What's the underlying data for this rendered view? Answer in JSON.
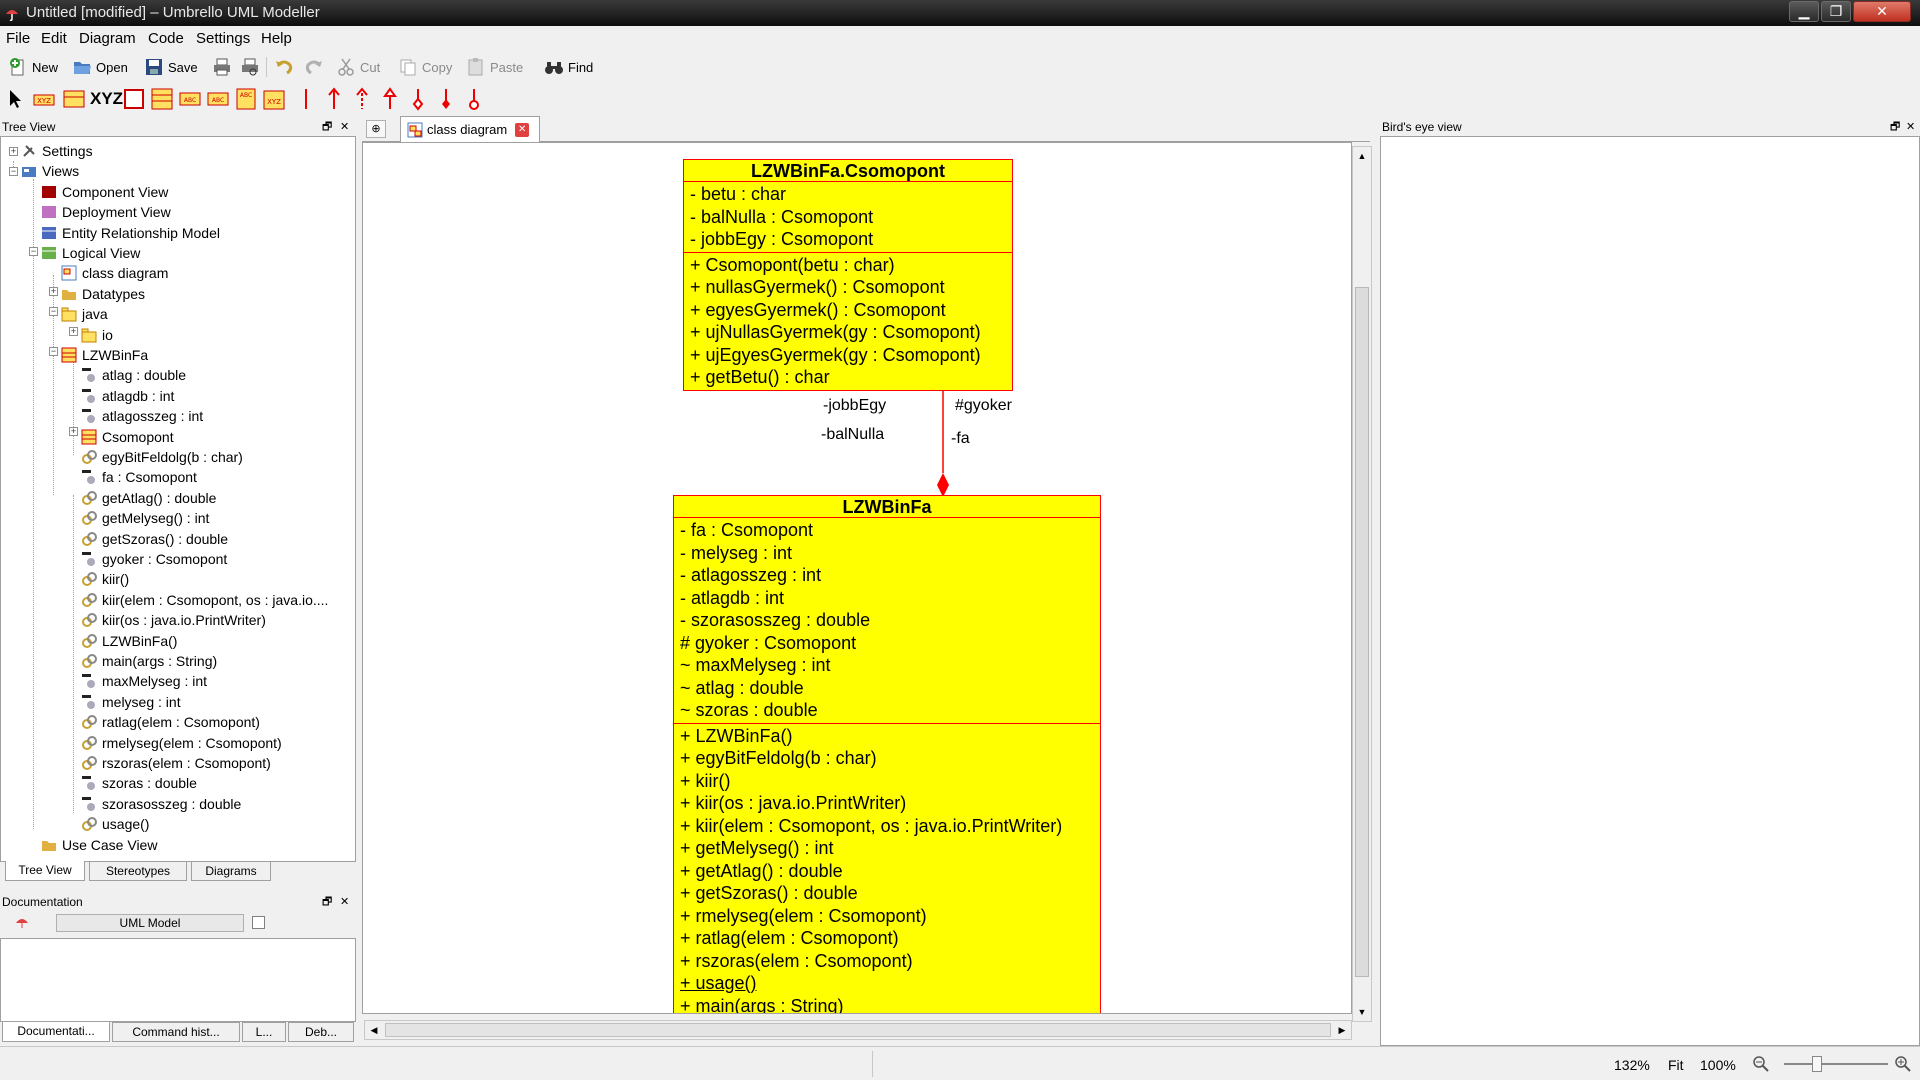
{
  "window": {
    "title": "Untitled [modified] – Umbrello UML Modeller"
  },
  "menu": [
    "File",
    "Edit",
    "Diagram",
    "Code",
    "Settings",
    "Help"
  ],
  "toolbar": {
    "new": "New",
    "open": "Open",
    "save": "Save",
    "cut": "Cut",
    "copy": "Copy",
    "paste": "Paste",
    "find": "Find"
  },
  "diagram_toolbar": {
    "xyz_label": "XYZ"
  },
  "tree_view": {
    "title": "Tree View",
    "items": [
      {
        "label": "Settings",
        "icon": "settings-icon"
      },
      {
        "label": "Views",
        "icon": "views-folder-icon"
      },
      {
        "label": "Component View",
        "icon": "component-view-icon"
      },
      {
        "label": "Deployment View",
        "icon": "deployment-view-icon"
      },
      {
        "label": "Entity Relationship Model",
        "icon": "er-model-icon"
      },
      {
        "label": "Logical View",
        "icon": "logical-view-icon"
      },
      {
        "label": "class diagram",
        "icon": "class-diagram-icon"
      },
      {
        "label": "Datatypes",
        "icon": "folder-icon"
      },
      {
        "label": "java",
        "icon": "package-icon"
      },
      {
        "label": "io",
        "icon": "package-icon"
      },
      {
        "label": "LZWBinFa",
        "icon": "class-icon"
      },
      {
        "label": "atlag : double",
        "icon": "attribute-icon"
      },
      {
        "label": "atlagdb : int",
        "icon": "attribute-icon"
      },
      {
        "label": "atlagosszeg : int",
        "icon": "attribute-icon"
      },
      {
        "label": "Csomopont",
        "icon": "class-icon"
      },
      {
        "label": "egyBitFeldolg(b : char)",
        "icon": "operation-icon"
      },
      {
        "label": "fa : Csomopont",
        "icon": "attribute-icon"
      },
      {
        "label": "getAtlag() : double",
        "icon": "operation-icon"
      },
      {
        "label": "getMelyseg() : int",
        "icon": "operation-icon"
      },
      {
        "label": "getSzoras() : double",
        "icon": "operation-icon"
      },
      {
        "label": "gyoker : Csomopont",
        "icon": "attribute-icon"
      },
      {
        "label": "kiir()",
        "icon": "operation-icon"
      },
      {
        "label": "kiir(elem : Csomopont, os : java.io....",
        "icon": "operation-icon"
      },
      {
        "label": "kiir(os : java.io.PrintWriter)",
        "icon": "operation-icon"
      },
      {
        "label": "LZWBinFa()",
        "icon": "operation-icon"
      },
      {
        "label": "main(args : String)",
        "icon": "operation-icon"
      },
      {
        "label": "maxMelyseg : int",
        "icon": "attribute-icon"
      },
      {
        "label": "melyseg : int",
        "icon": "attribute-icon"
      },
      {
        "label": "ratlag(elem : Csomopont)",
        "icon": "operation-icon"
      },
      {
        "label": "rmelyseg(elem : Csomopont)",
        "icon": "operation-icon"
      },
      {
        "label": "rszoras(elem : Csomopont)",
        "icon": "operation-icon"
      },
      {
        "label": "szoras : double",
        "icon": "attribute-icon"
      },
      {
        "label": "szorasosszeg : double",
        "icon": "attribute-icon"
      },
      {
        "label": "usage()",
        "icon": "operation-icon"
      },
      {
        "label": "Use Case View",
        "icon": "folder-icon"
      }
    ],
    "tabs": [
      "Tree View",
      "Stereotypes",
      "Diagrams"
    ]
  },
  "documentation": {
    "title": "Documentation",
    "model_label": "UML Model",
    "tabs": [
      "Documentati...",
      "Command hist...",
      "L...",
      "Deb..."
    ]
  },
  "diagram_tab": {
    "label": "class diagram"
  },
  "birds_eye": {
    "title": "Bird's eye view"
  },
  "diagram": {
    "classes": [
      {
        "name": "LZWBinFa.Csomopont",
        "attributes": [
          "- betu : char",
          "- balNulla : Csomopont",
          "- jobbEgy : Csomopont"
        ],
        "operations": [
          {
            "text": "+ Csomopont(betu : char)",
            "static": false
          },
          {
            "text": "+ nullasGyermek() : Csomopont",
            "static": false
          },
          {
            "text": "+ egyesGyermek() : Csomopont",
            "static": false
          },
          {
            "text": "+ ujNullasGyermek(gy : Csomopont)",
            "static": false
          },
          {
            "text": "+ ujEgyesGyermek(gy : Csomopont)",
            "static": false
          },
          {
            "text": "+ getBetu() : char",
            "static": false
          }
        ]
      },
      {
        "name": "LZWBinFa",
        "attributes": [
          "- fa : Csomopont",
          "- melyseg : int",
          "- atlagosszeg : int",
          "- atlagdb : int",
          "- szorasosszeg : double",
          "# gyoker : Csomopont",
          "~ maxMelyseg : int",
          "~ atlag : double",
          "~ szoras : double"
        ],
        "operations": [
          {
            "text": "+ LZWBinFa()",
            "static": false
          },
          {
            "text": "+ egyBitFeldolg(b : char)",
            "static": false
          },
          {
            "text": "+ kiir()",
            "static": false
          },
          {
            "text": "+ kiir(os : java.io.PrintWriter)",
            "static": false
          },
          {
            "text": "+ kiir(elem : Csomopont, os : java.io.PrintWriter)",
            "static": false
          },
          {
            "text": "+ getMelyseg() : int",
            "static": false
          },
          {
            "text": "+ getAtlag() : double",
            "static": false
          },
          {
            "text": "+ getSzoras() : double",
            "static": false
          },
          {
            "text": "+ rmelyseg(elem : Csomopont)",
            "static": false
          },
          {
            "text": "+ ratlag(elem : Csomopont)",
            "static": false
          },
          {
            "text": "+ rszoras(elem : Csomopont)",
            "static": false
          },
          {
            "text": "+ usage()",
            "static": true
          },
          {
            "text": "+ main(args : String)",
            "static": true
          }
        ]
      }
    ],
    "association_labels": {
      "jobbEgy": "-jobbEgy",
      "balNulla": "-balNulla",
      "gyoker": "#gyoker",
      "fa": "-fa"
    },
    "colors": {
      "fill": "#ffff00",
      "line": "#ff0000"
    }
  },
  "statusbar": {
    "zoom": "132%",
    "fit": "Fit",
    "hundred": "100%"
  }
}
